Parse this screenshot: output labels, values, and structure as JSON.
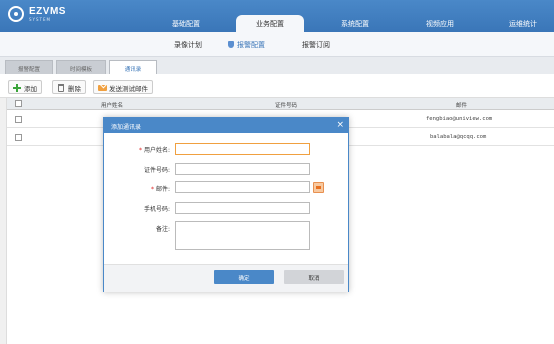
{
  "app": {
    "title": "EZVMS",
    "subtitle": "SYSTEM"
  },
  "main_nav": [
    {
      "label": "基础配置"
    },
    {
      "label": "业务配置",
      "active": true
    },
    {
      "label": "系统配置"
    },
    {
      "label": "视频应用"
    },
    {
      "label": "运维统计"
    }
  ],
  "sub_nav": [
    {
      "label": "录像计划"
    },
    {
      "label": "报警配置",
      "active": true
    },
    {
      "label": "报警订阅"
    }
  ],
  "tabs": [
    {
      "label": "报警配置"
    },
    {
      "label": "时间模板"
    },
    {
      "label": "通讯录",
      "active": true
    }
  ],
  "toolbar": {
    "add_label": "添加",
    "delete_label": "删除",
    "send_test_label": "发送测试邮件"
  },
  "table": {
    "columns": [
      "用户姓名",
      "证件号码",
      "邮件"
    ],
    "rows": [
      {
        "name": "",
        "id_number": "",
        "email": "fengbiao@uniview.com"
      },
      {
        "name": "",
        "id_number": "",
        "email": "balabala@qcqq.com"
      }
    ]
  },
  "modal": {
    "title": "添加通讯录",
    "close_glyph": "×",
    "fields": {
      "name_label": "用户姓名:",
      "name_value": "",
      "id_label": "证件号码:",
      "id_value": "",
      "email_label": "邮件:",
      "email_value": "",
      "phone_label": "手机号码:",
      "phone_value": "",
      "note_label": "备注:",
      "note_value": ""
    },
    "ok_label": "确定",
    "cancel_label": "取消"
  },
  "colors": {
    "accent": "#4a88c8",
    "required": "#dd2222",
    "focus": "#f0a040"
  }
}
